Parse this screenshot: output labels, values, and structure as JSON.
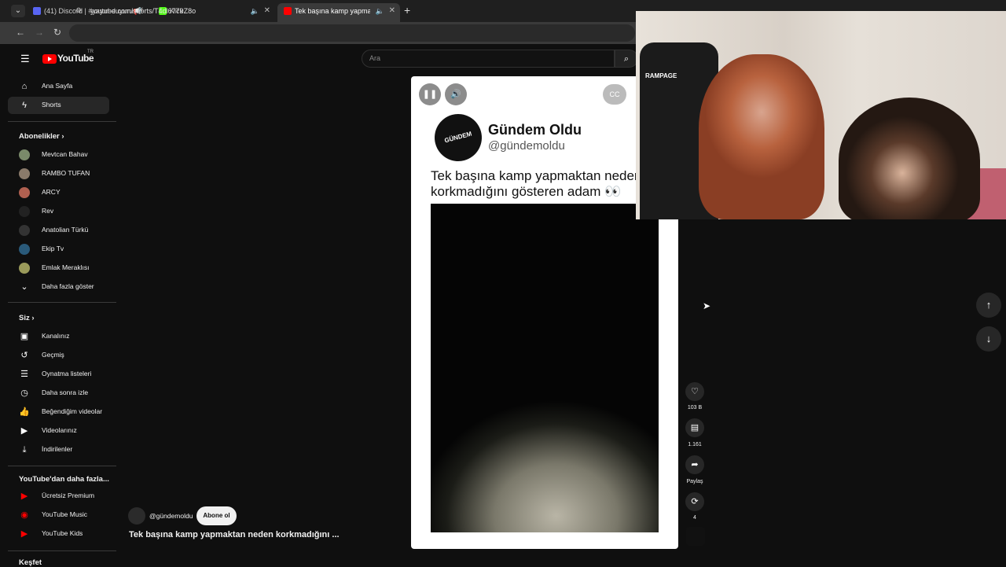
{
  "browser": {
    "tabs": [
      {
        "label": "(41) Discord | #yayın-duyuru📢",
        "fav_color": "#5865f2"
      },
      {
        "label": "Kick",
        "fav_color": "#53fc18"
      },
      {
        "label": "Tek başına kamp yapmakta",
        "fav_color": "#ff0000"
      }
    ],
    "new_tab": "+",
    "url": "youtube.com/shorts/T4dl6779Z8o"
  },
  "youtube": {
    "logo_text": "YouTube",
    "region": "TR",
    "search_placeholder": "Ara"
  },
  "sidebar": {
    "main": [
      {
        "label": "Ana Sayfa",
        "icon": "home-icon"
      },
      {
        "label": "Shorts",
        "icon": "shorts-icon"
      }
    ],
    "subs_title": "Abonelikler",
    "subscriptions": [
      {
        "label": "Mevtcan Bahav",
        "color": "#7a8a6a"
      },
      {
        "label": "RAMBO TUFAN",
        "color": "#8a7a6a"
      },
      {
        "label": "ARCY",
        "color": "#b06050"
      },
      {
        "label": "Rev",
        "color": "#222222"
      },
      {
        "label": "Anatolian Türkü",
        "color": "#333333"
      },
      {
        "label": "Ekip Tv",
        "color": "#2a5a7a"
      },
      {
        "label": "Emlak Meraklısı",
        "color": "#9a9a5a"
      }
    ],
    "show_more": "Daha fazla göster",
    "you_title": "Siz",
    "you": [
      {
        "label": "Kanalınız",
        "icon": "channel-icon"
      },
      {
        "label": "Geçmiş",
        "icon": "history-icon"
      },
      {
        "label": "Oynatma listeleri",
        "icon": "playlist-icon"
      },
      {
        "label": "Daha sonra izle",
        "icon": "clock-icon"
      },
      {
        "label": "Beğendiğim videolar",
        "icon": "thumbs-up-icon"
      },
      {
        "label": "Videolarınız",
        "icon": "video-icon"
      },
      {
        "label": "İndirilenler",
        "icon": "download-icon"
      }
    ],
    "more_title": "YouTube'dan daha fazla...",
    "more": [
      {
        "label": "Ücretsiz Premium"
      },
      {
        "label": "YouTube Music"
      },
      {
        "label": "YouTube Kids"
      }
    ],
    "explore_title": "Keşfet"
  },
  "short": {
    "channel_name": "Gündem Oldu",
    "channel_handle": "@gündemoldu",
    "logo_text": "GÜNDEM OLDU",
    "caption": "Tek başına kamp yapmaktan neden korkmadığını gösteren adam 👀",
    "meta_handle": "@gündemoldu",
    "subscribe": "Abone ol",
    "meta_title": "Tek başına kamp yapmaktan neden korkmadığını ..."
  },
  "actions": {
    "likes": "103 B",
    "comments": "1.161",
    "share": "Paylaş",
    "remix": "4"
  },
  "webcam": {
    "chair_brand": "RAMPAGE"
  }
}
